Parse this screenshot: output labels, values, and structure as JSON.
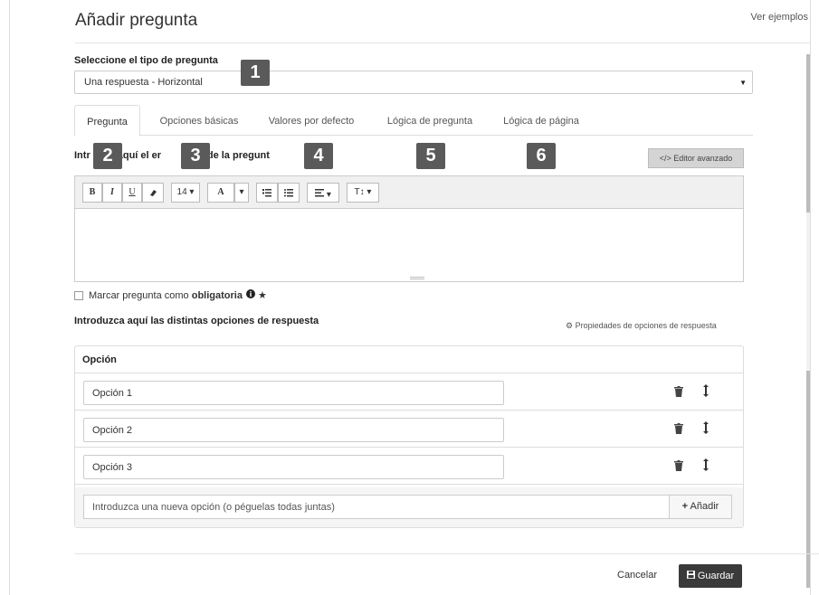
{
  "header": {
    "title": "Añadir pregunta",
    "examples_link": "Ver ejemplos"
  },
  "question_type": {
    "label": "Seleccione el tipo de pregunta",
    "selected": "Una respuesta - Horizontal"
  },
  "tabs": [
    {
      "label": "Pregunta",
      "active": true
    },
    {
      "label": "Opciones básicas"
    },
    {
      "label": "Valores por defecto"
    },
    {
      "label": "Lógica de pregunta"
    },
    {
      "label": "Lógica de página"
    }
  ],
  "callouts": [
    "1",
    "2",
    "3",
    "4",
    "5",
    "6"
  ],
  "question_text": {
    "label_visible_parts": [
      "Intr",
      "aquí el er",
      "lo de la pregunt"
    ],
    "advanced_editor_button": "</> Editor avanzado"
  },
  "toolbar": {
    "bold": "B",
    "italic": "I",
    "underline": "U",
    "eraser": "eraser-icon",
    "font_size": "14",
    "text_color": "A",
    "ordered_list": "ordered-list-icon",
    "unordered_list": "unordered-list-icon",
    "align": "align-icon",
    "heading": "T↕"
  },
  "required": {
    "prefix": "Marcar pregunta como ",
    "bold": "obligatoria",
    "checked": false
  },
  "answer_options": {
    "label": "Introduzca aquí las distintas opciones de respuesta",
    "properties_link": "Propiedades de opciones de respuesta",
    "column_header": "Opción",
    "rows": [
      {
        "value": "Opción 1"
      },
      {
        "value": "Opción 2"
      },
      {
        "value": "Opción 3"
      }
    ],
    "new_option_placeholder": "Introduzca una nueva opción (o péguelas todas juntas)",
    "add_button": "Añadir"
  },
  "footer": {
    "cancel": "Cancelar",
    "save": "Guardar"
  }
}
